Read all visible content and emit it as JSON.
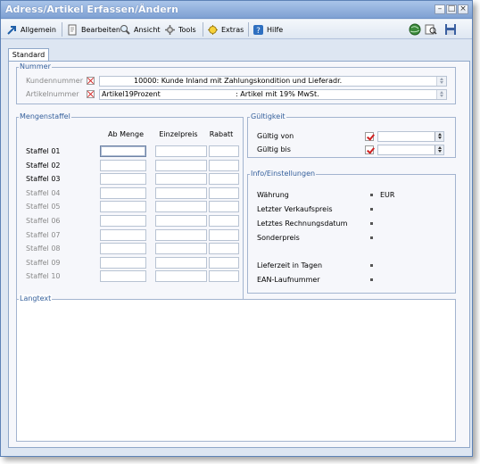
{
  "window": {
    "title": "Adress/Artikel Erfassen/Ändern"
  },
  "toolbar": {
    "items": [
      {
        "label": "Allgemein",
        "icon": "arrow-icon"
      },
      {
        "label": "Bearbeiten",
        "icon": "edit-icon"
      },
      {
        "label": "Ansicht",
        "icon": "view-icon"
      },
      {
        "label": "Tools",
        "icon": "tools-icon"
      },
      {
        "label": "Extras",
        "icon": "extras-icon"
      },
      {
        "label": "Hilfe",
        "icon": "help-icon"
      }
    ]
  },
  "tabs": [
    {
      "label": "Standard",
      "active": true
    }
  ],
  "nummer": {
    "legend": "Nummer",
    "kundennummer_label": "Kundennummer",
    "kundennummer_value": "10000: Kunde Inland mit Zahlungskondition und Lieferadr.",
    "artikelnummer_label": "Artikelnummer",
    "artikelnummer_code": "Artikel19Prozent",
    "artikelnummer_desc": ": Artikel mit 19% MwSt."
  },
  "mengenstaffel": {
    "legend": "Mengenstaffel",
    "columns": [
      "Ab Menge",
      "Einzelpreis",
      "Rabatt"
    ],
    "rows": [
      {
        "label": "Staffel 01",
        "enabled": true
      },
      {
        "label": "Staffel 02",
        "enabled": true
      },
      {
        "label": "Staffel 03",
        "enabled": true
      },
      {
        "label": "Staffel 04",
        "enabled": false
      },
      {
        "label": "Staffel 05",
        "enabled": false
      },
      {
        "label": "Staffel 06",
        "enabled": false
      },
      {
        "label": "Staffel 07",
        "enabled": false
      },
      {
        "label": "Staffel 08",
        "enabled": false
      },
      {
        "label": "Staffel 09",
        "enabled": false
      },
      {
        "label": "Staffel 10",
        "enabled": false
      }
    ]
  },
  "gueltigkeit": {
    "legend": "Gültigkeit",
    "von_label": "Gültig von",
    "bis_label": "Gültig bis"
  },
  "info": {
    "legend": "Info/Einstellungen",
    "rows": [
      {
        "label": "Währung",
        "value": "EUR"
      },
      {
        "label": "Letzter Verkaufspreis",
        "value": ""
      },
      {
        "label": "Letztes Rechnungsdatum",
        "value": ""
      },
      {
        "label": "Sonderpreis",
        "value": ""
      },
      {
        "label": "Lieferzeit in Tagen",
        "value": ""
      },
      {
        "label": "EAN-Laufnummer",
        "value": ""
      }
    ]
  },
  "langtext": {
    "legend": "Langtext"
  },
  "colors": {
    "title_bar": "#7fa1d3",
    "legend_text": "#35609c",
    "red_mark": "#d02020",
    "panel_bg": "#dde6f2"
  }
}
